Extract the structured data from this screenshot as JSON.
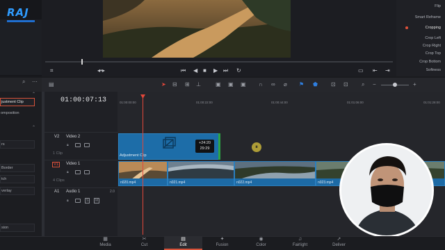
{
  "logo": "RAJ",
  "inspector": {
    "items": [
      "Flip",
      "Smart Reframe",
      "Cropping",
      "Crop Left",
      "Crop Right",
      "Crop Top",
      "Crop Bottom",
      "Softness"
    ]
  },
  "left_panel": {
    "items": [
      "justment Clip",
      "omposition",
      "rs",
      "Border",
      "tch",
      "verlay",
      "sion"
    ]
  },
  "timecode": "01:00:07:13",
  "ruler": [
    "01:00:00:00",
    "01:00:22:00",
    "01:00:44:00",
    "01:01:06:00",
    "01:01:28:00"
  ],
  "tracks": {
    "v2": {
      "id": "V2",
      "name": "Video 2",
      "clips": "1 Clip"
    },
    "v1": {
      "id": "V1",
      "name": "Video 1",
      "clips": "4 Clips"
    },
    "a1": {
      "id": "A1",
      "name": "Audio 1",
      "channels": "2.0",
      "s": "S",
      "m": "M"
    }
  },
  "adjustment_clip": {
    "label": "Adjustment Clip",
    "tip_line1": "+24:20",
    "tip_line2": "29:29"
  },
  "video_clips": [
    "n020.mp4",
    "n021.mp4",
    "n022.mp4",
    "n023.mp4"
  ],
  "page_tabs": [
    "Media",
    "Cut",
    "Edit",
    "Fusion",
    "Color",
    "Fairlight",
    "Deliver"
  ],
  "colors": {
    "accent": "#d8533a",
    "clip_blue": "#1d6da8",
    "playhead": "#e2473a",
    "logo_blue": "#2f9cff"
  }
}
